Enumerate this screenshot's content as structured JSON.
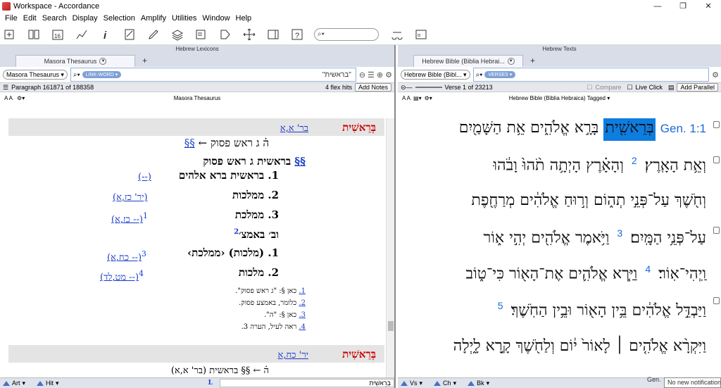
{
  "window": {
    "title": "Workspace - Accordance",
    "min": "—",
    "restore": "❐",
    "close": "✕"
  },
  "menu": [
    "File",
    "Edit",
    "Search",
    "Display",
    "Selection",
    "Amplify",
    "Utilities",
    "Window",
    "Help"
  ],
  "toolbar": {
    "search_placeholder": ""
  },
  "left": {
    "group_title": "Hebrew Lexicons",
    "tab_label": "Masora Thesaurus",
    "module_select": "Masora Thesaurus",
    "search_type": "LINK-WORD",
    "search_text": "\"בראשית\"",
    "paragraph_info": "Paragraph 161871 of 188358",
    "hits": "4 flex hits",
    "add_notes": "Add Notes",
    "pane_title": "Masora Thesaurus",
    "entry1": {
      "ref": "בר' א,א",
      "word": "בְּרֵאשִׁית",
      "l1_prefix": "ה֗ ג ראש פסוק",
      "l1_link": "§§",
      "l2_link": "§§",
      "l2_text": "בראשית ג ראש פסוק",
      "items": [
        {
          "num": "1.",
          "text": "בראשית ברא אלהים",
          "ref": "(--)"
        },
        {
          "num": "2.",
          "text": "ממלכות",
          "ref": "(יר' כז,א)"
        },
        {
          "num": "3.",
          "text": "ממלכת",
          "ref": "(-- כז,א)",
          "sup": "1"
        }
      ],
      "sub_heading": "וב׳ באמצ׳",
      "sub_sup": "2",
      "sub_items": [
        {
          "num": "1.",
          "text": "(מלכות) ‹ממלכת›",
          "ref": "(-- כח,א)",
          "sup": "3"
        },
        {
          "num": "2.",
          "text": "מלכות",
          "ref": "(-- מט,לד)",
          "sup": "4"
        }
      ],
      "footnotes": [
        {
          "num": "1.",
          "text": "כאן §: \"ג ראש פסוק\"."
        },
        {
          "num": "2.",
          "text": "כלומר, באמצע פסוק."
        },
        {
          "num": "3.",
          "text": "כאן §: \"ה\"."
        },
        {
          "num": "4.",
          "text": "ראה לעיל, הערה 3."
        }
      ]
    },
    "entry2": {
      "ref": "יר' כח,א",
      "word": "בְּרֵאשִׁית",
      "line": "ה֗ ← §§ בראשית (בר' א,א)"
    },
    "bottom": {
      "art": "Art",
      "hit": "Hit",
      "search_word": "בְּרֵאשִׁית"
    }
  },
  "right": {
    "group_title": "Hebrew Texts",
    "tab_label": "Hebrew Bible (Biblia Hebrai...",
    "module_select": "Hebrew Bible (Bibl...",
    "search_type": "VERSES",
    "verse_info": "Verse 1 of 23213",
    "compare": "Compare",
    "live_click": "Live Click",
    "add_parallel": "Add Parallel",
    "pane_title": "Hebrew Bible (Biblia Hebraica) Tagged",
    "ref": "Gen. 1:1",
    "highlight_word": "בְּרֵאשִׁ֖ית",
    "lines": [
      "בָּרָ֣א אֱלֹהִ֑ים אֵ֥ת הַשָּׁמַ֖יִם",
      "וְאֵ֥ת הָאָֽרֶץ׃",
      "וְהָאָ֗רֶץ הָיְתָ֥ה תֹ֨הוּ֙ וָבֹ֔הוּ",
      "וְחֹ֖שֶׁךְ עַל־פְּנֵ֣י תְה֑וֹם וְר֣וּחַ אֱלֹהִ֔ים מְרַחֶ֖פֶת",
      "עַל־פְּנֵ֥י הַמָּֽיִם׃",
      "וַיֹּ֥אמֶר אֱלֹהִ֖ים יְהִ֣י א֑וֹר",
      "וַֽיְהִי־אֽוֹר׃",
      "וַיַּ֧רְא אֱלֹהִ֛ים אֶת־הָא֖וֹר כִּי־ט֑וֹב",
      "וַיַּבְדֵּ֣ל אֱלֹהִ֔ים בֵּ֥ין הָא֖וֹר וּבֵ֥ין הַחֹֽשֶׁךְ׃",
      "וַיִּקְרָ֨א אֱלֹהִ֤ים ׀ לָאוֹר֙ י֔וֹם וְלַחֹ֖שֶׁךְ קָ֣רָא לָ֑יְלָה"
    ],
    "verse_nums": {
      "v2": "2",
      "v3": "3",
      "v4": "4",
      "v5": "5"
    },
    "bottom": {
      "vs": "Vs",
      "ch": "Ch",
      "bk": "Bk",
      "gen": "Gen."
    },
    "notification": "No new notifications"
  }
}
